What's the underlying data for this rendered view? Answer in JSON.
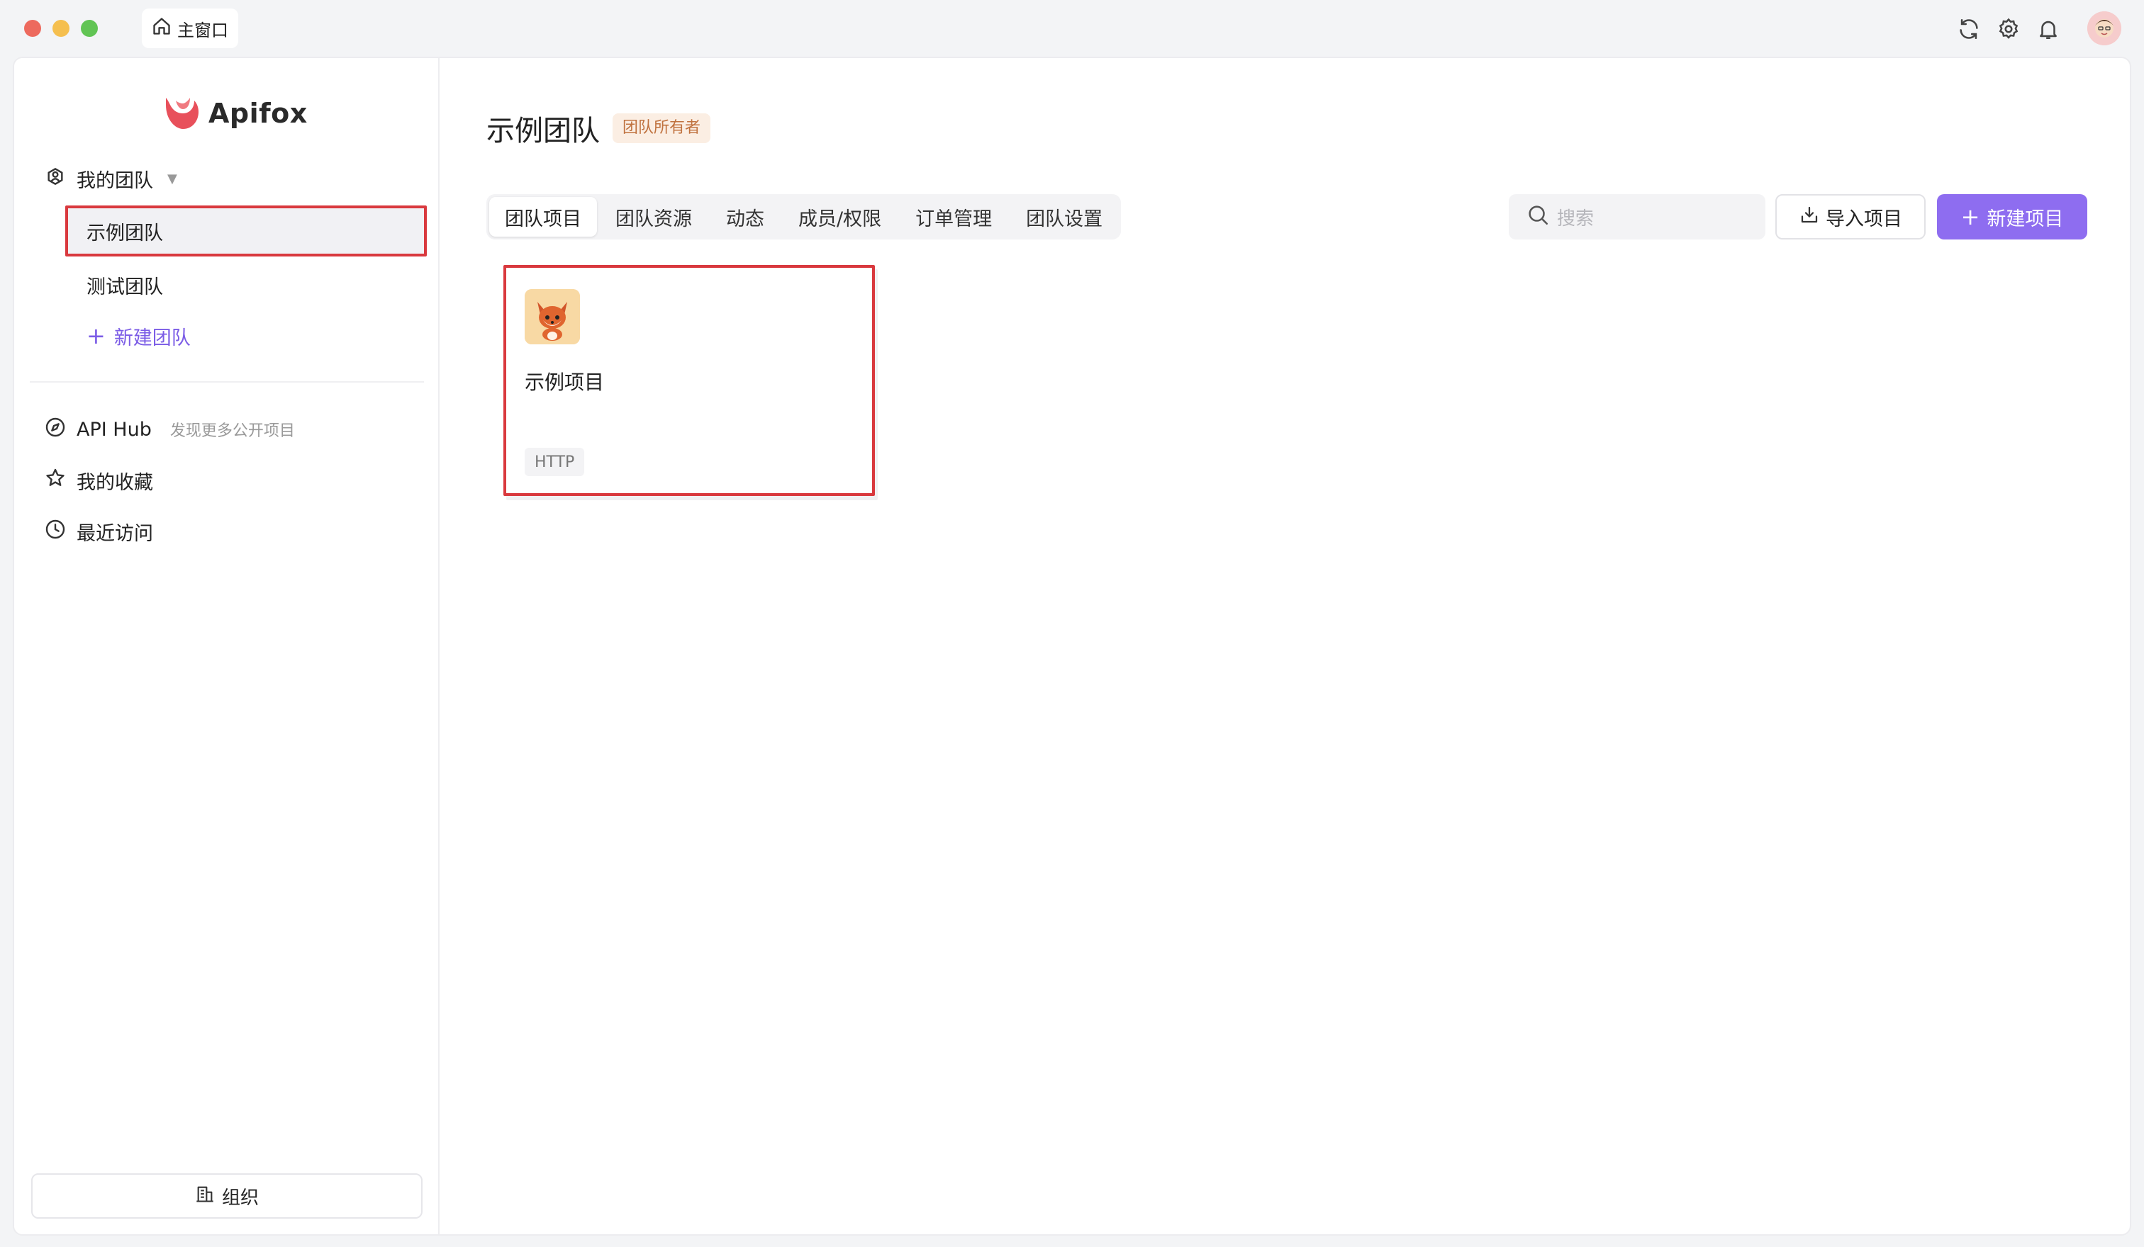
{
  "titlebar": {
    "home_tab_label": "主窗口"
  },
  "sidebar": {
    "logo_text": "Apifox",
    "my_teams_label": "我的团队",
    "teams": [
      {
        "label": "示例团队",
        "active": true
      },
      {
        "label": "测试团队",
        "active": false
      }
    ],
    "new_team_label": "新建团队",
    "api_hub_label": "API Hub",
    "api_hub_hint": "发现更多公开项目",
    "favorites_label": "我的收藏",
    "recent_label": "最近访问",
    "org_button_label": "组织"
  },
  "main": {
    "title": "示例团队",
    "owner_badge": "团队所有者",
    "tabs": [
      {
        "label": "团队项目",
        "active": true
      },
      {
        "label": "团队资源",
        "active": false
      },
      {
        "label": "动态",
        "active": false
      },
      {
        "label": "成员/权限",
        "active": false
      },
      {
        "label": "订单管理",
        "active": false
      },
      {
        "label": "团队设置",
        "active": false
      }
    ],
    "search_placeholder": "搜索",
    "import_label": "导入项目",
    "new_project_label": "新建项目",
    "projects": [
      {
        "name": "示例项目",
        "tag": "HTTP",
        "icon": "fox-icon"
      }
    ]
  },
  "colors": {
    "accent": "#8e6df0",
    "link": "#7b5ce6",
    "highlight_border": "#d9393e",
    "badge_text": "#c0723f",
    "badge_bg": "#fbeee3",
    "logo": "#e8505b"
  }
}
